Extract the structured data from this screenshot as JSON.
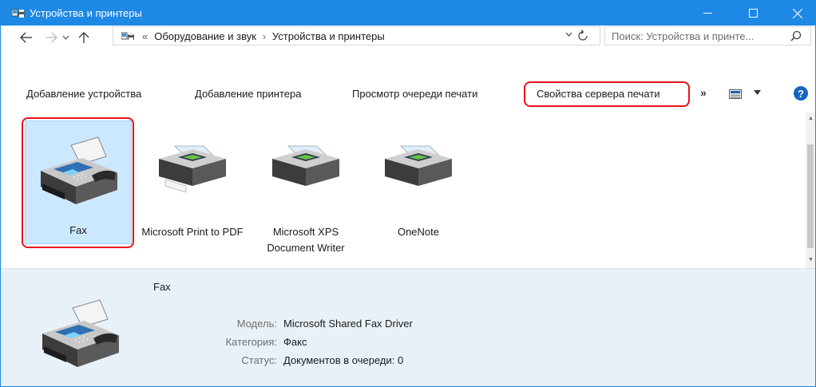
{
  "window": {
    "title": "Устройства и принтеры",
    "accent_color": "#1e88e5"
  },
  "addressbar": {
    "overflow": "«",
    "crumbs": [
      "Оборудование и звук",
      "Устройства и принтеры"
    ],
    "search_placeholder": "Поиск: Устройства и принте..."
  },
  "commands": {
    "add_device": "Добавление устройства",
    "add_printer": "Добавление принтера",
    "view_queue": "Просмотр очереди печати",
    "server_properties": "Свойства сервера печати",
    "more": "»",
    "help": "?"
  },
  "devices": [
    {
      "label": "Fax",
      "icon": "fax-icon",
      "selected": true
    },
    {
      "label": "Microsoft Print to PDF",
      "icon": "printer-icon",
      "selected": false
    },
    {
      "label": "Microsoft XPS Document Writer",
      "icon": "printer-icon",
      "selected": false
    },
    {
      "label": "OneNote",
      "icon": "printer-icon",
      "selected": false
    }
  ],
  "details": {
    "name": "Fax",
    "properties": [
      {
        "key": "Модель:",
        "value": "Microsoft Shared Fax Driver"
      },
      {
        "key": "Категория:",
        "value": "Факс"
      },
      {
        "key": "Статус:",
        "value": "Документов в очереди: 0"
      }
    ]
  },
  "highlight_color": "#e8111e"
}
